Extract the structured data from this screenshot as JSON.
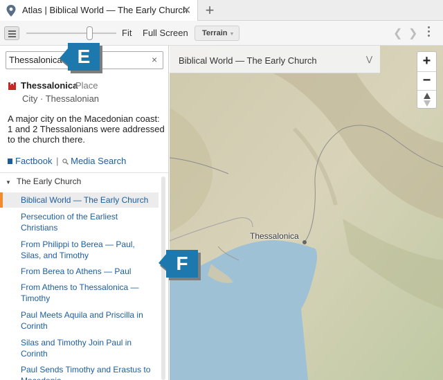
{
  "tab": {
    "title": "Atlas | Biblical World — The Early Church",
    "close": "✕",
    "add": "+"
  },
  "toolbar": {
    "fit_label": "Fit",
    "fullscreen_label": "Full Screen",
    "terrain_label": "Terrain",
    "slider_value": 0.7
  },
  "search": {
    "value": "Thessalonica",
    "clear": "×"
  },
  "place": {
    "name": "Thessalonica",
    "type": "Place",
    "subtitle": "City · Thessalonian",
    "description": "A major city on the Macedonian coast: 1 and 2 Thessalonians were addressed to the church there.",
    "links": {
      "factbook": "Factbook",
      "separator": "|",
      "media_search": "Media Search"
    }
  },
  "list": {
    "group": "The Early Church",
    "items": [
      "Biblical World — The Early Church",
      "Persecution of the Earliest Christians",
      "From Philippi to Berea — Paul, Silas, and Timothy",
      "From Berea to Athens — Paul",
      "From Athens to Thessalonica — Timothy",
      "Paul Meets Aquila and Priscilla in Corinth",
      "Silas and Timothy Join Paul in Corinth",
      "Paul Sends Timothy and Erastus to Macedonia"
    ]
  },
  "map": {
    "title": "Biblical World — The Early Church",
    "city_label": "Thessalonica",
    "zoom_in": "+",
    "zoom_out": "−"
  },
  "callouts": {
    "e": "E",
    "f": "F"
  },
  "colors": {
    "link": "#1b5d9e",
    "active_marker": "#f08c2e",
    "callout": "#1d78ad",
    "water": "#9ec1d6",
    "land": "#c9c3a6"
  }
}
